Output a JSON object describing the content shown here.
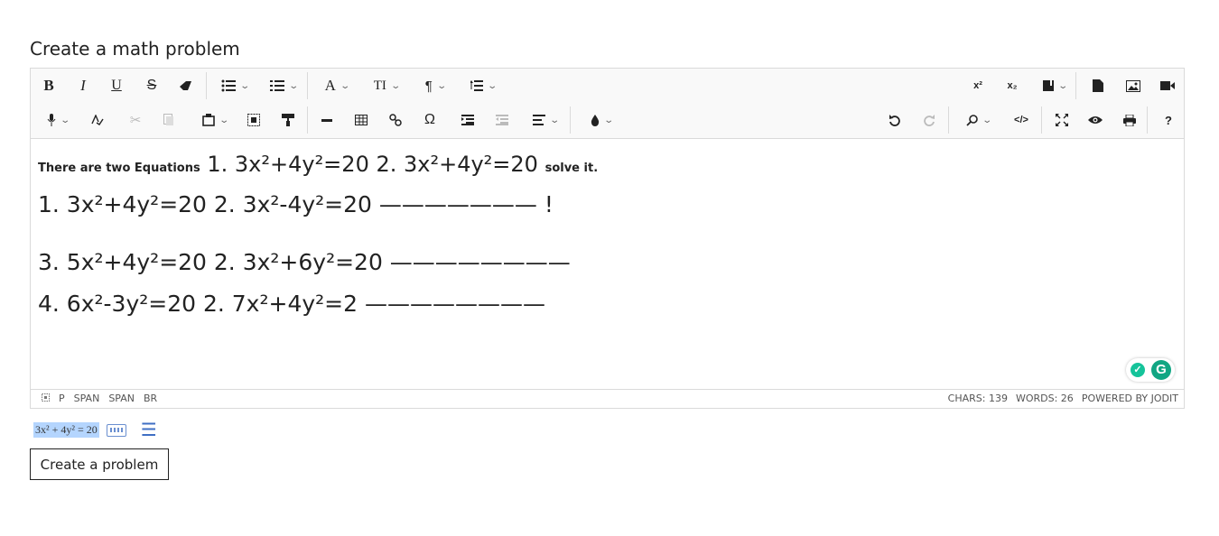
{
  "page": {
    "title": "Create a math problem"
  },
  "toolbar": {
    "row1": {
      "bold": "B",
      "italic": "I",
      "underline": "U",
      "strikethrough": "S",
      "font": "A",
      "font_size": "TI",
      "paragraph": "¶",
      "superscript": "x²",
      "subscript": "x₂"
    },
    "row2": {
      "symbols": "Ω",
      "source": "</>",
      "help": "?"
    }
  },
  "content": {
    "line1_prefix": "There are two Equations",
    "line1_eq": "1. 3x²+4y²=20  2. 3x²+4y²=20",
    "line1_suffix": "solve it.",
    "line2": "1. 3x²+4y²=20  2. 3x²-4y²=20 ———————  !",
    "line3": "3. 5x²+4y²=20  2. 3x²+6y²=20 ————————",
    "line4": "4. 6x²-3y²=20  2. 7x²+4y²=2 ————————"
  },
  "statusbar": {
    "path": [
      "P",
      "SPAN",
      "SPAN",
      "BR"
    ],
    "chars": "CHARS: 139",
    "words": "WORDS: 26",
    "powered": "POWERED BY JODIT"
  },
  "formula": {
    "text": "3x² + 4y² = 20"
  },
  "create_button": {
    "label": "Create a problem"
  }
}
